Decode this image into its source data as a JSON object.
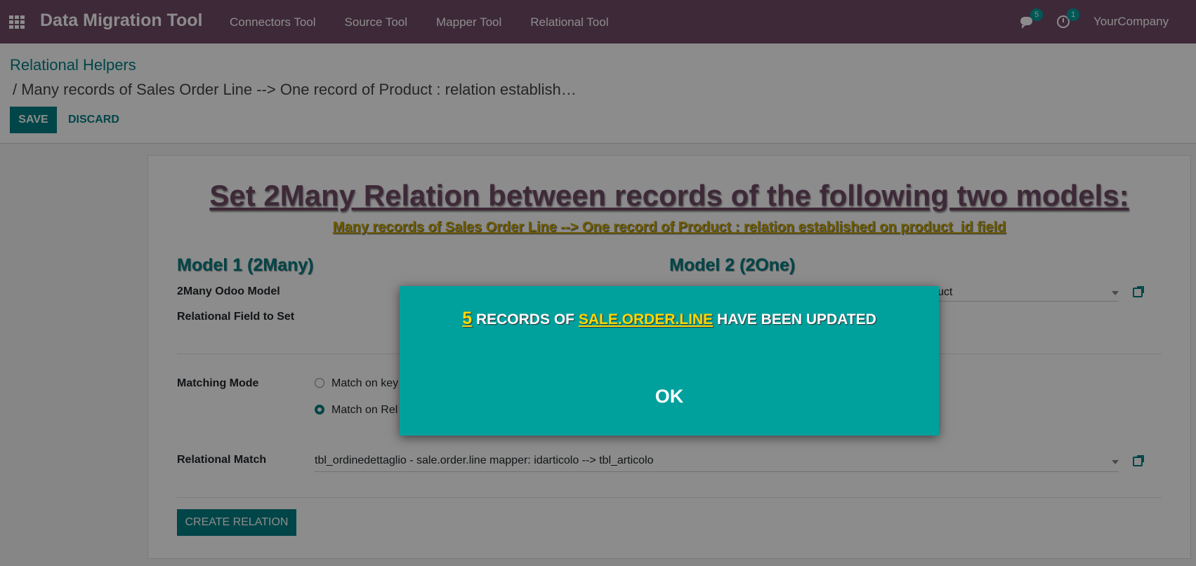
{
  "navbar": {
    "app_title": "Data Migration Tool",
    "menu": [
      "Connectors Tool",
      "Source Tool",
      "Mapper Tool",
      "Relational Tool"
    ],
    "messages_count": "5",
    "activities_count": "1",
    "company": "YourCompany",
    "color": "#714B67"
  },
  "control_panel": {
    "breadcrumb_parent": "Relational Helpers",
    "breadcrumb_current": "/ Many records of Sales Order Line --> One record of Product : relation establish…",
    "save_label": "SAVE",
    "discard_label": "DISCARD"
  },
  "form": {
    "title": "Set 2Many Relation between records of the following two models:",
    "subtitle": "Many records of Sales Order Line --> One record of Product : relation established on product_id field",
    "model1_heading": "Model 1 (2Many)",
    "model2_heading": "Model 2 (2One)",
    "many_model_label": "2Many Odoo Model",
    "relational_field_label": "Relational Field to Set",
    "one_model_value_fragment": "uct",
    "matching_mode_label": "Matching Mode",
    "matching_options": [
      "Match on key",
      "Match on Rel"
    ],
    "matching_selected_index": 1,
    "relational_match_label": "Relational Match",
    "relational_match_value": "tbl_ordinedettaglio - sale.order.line mapper: idarticolo --> tbl_articolo",
    "create_relation_label": "CREATE RELATION"
  },
  "dialog": {
    "count": "5",
    "text_before": "RECORDS OF",
    "model": "SALE.ORDER.LINE",
    "text_after": "HAVE BEEN UPDATED",
    "ok_label": "OK",
    "background": "#00A09D"
  }
}
